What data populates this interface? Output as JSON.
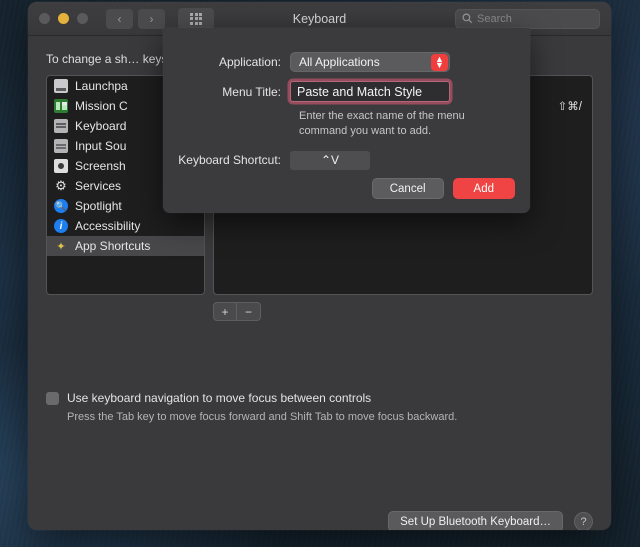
{
  "window": {
    "title": "Keyboard",
    "traffic_lights": [
      "close-disabled",
      "minimize",
      "zoom-disabled"
    ],
    "nav_back": "‹",
    "nav_forward": "›",
    "grid_icon": "all-preferences-grid-icon",
    "search": {
      "placeholder": "Search",
      "value": "",
      "icon": "search-icon"
    }
  },
  "main": {
    "intro_text": "To change a sh…                                                                                   keys.",
    "sidebar": {
      "items": [
        {
          "label": "Launchpa",
          "icon": "launchpad-icon",
          "selected": false
        },
        {
          "label": "Mission C",
          "icon": "mission-control-icon",
          "selected": false
        },
        {
          "label": "Keyboard",
          "icon": "keyboard-icon",
          "selected": false
        },
        {
          "label": "Input Sou",
          "icon": "input-sources-icon",
          "selected": false
        },
        {
          "label": "Screensh",
          "icon": "screenshots-icon",
          "selected": false
        },
        {
          "label": "Services",
          "icon": "services-gear-icon",
          "selected": false
        },
        {
          "label": "Spotlight",
          "icon": "spotlight-icon",
          "selected": false
        },
        {
          "label": "Accessibility",
          "icon": "accessibility-icon",
          "selected": false
        },
        {
          "label": "App Shortcuts",
          "icon": "app-shortcuts-icon",
          "selected": true
        }
      ]
    },
    "shortcut_table": {
      "rows": [
        {
          "name": "",
          "shortcut": "⇧⌘/"
        }
      ]
    },
    "add_button_label": "+",
    "remove_button_label": "−",
    "keyboard_nav": {
      "checkbox_checked": false,
      "label": "Use keyboard navigation to move focus between controls",
      "sub_label": "Press the Tab key to move focus forward and Shift Tab to move focus backward."
    },
    "bluetooth_button_label": "Set Up Bluetooth Keyboard…",
    "help_button_label": "?"
  },
  "sheet": {
    "application": {
      "label": "Application:",
      "value": "All Applications",
      "popup_icon": "updown-chevron-icon",
      "accent_color": "#f03e3e"
    },
    "menu_title": {
      "label": "Menu Title:",
      "value": "Paste and Match Style",
      "placeholder": "",
      "focus_ring_color": "#e65a78"
    },
    "hint": "Enter the exact name of the menu command you want to add.",
    "keyboard_shortcut": {
      "label": "Keyboard Shortcut:",
      "value": "⌃V"
    },
    "cancel_label": "Cancel",
    "add_label": "Add"
  }
}
